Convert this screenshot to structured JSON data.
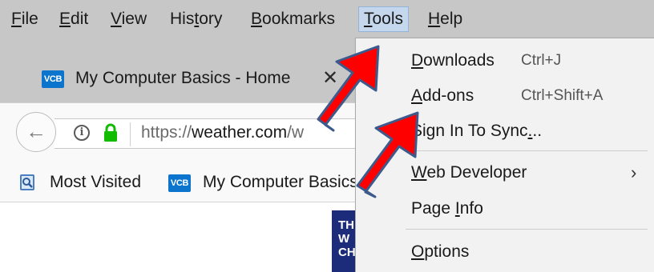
{
  "menubar": {
    "items": [
      {
        "label": "File",
        "underline_index": 0
      },
      {
        "label": "Edit",
        "underline_index": 0
      },
      {
        "label": "View",
        "underline_index": 0
      },
      {
        "label": "History",
        "underline_index": 3
      },
      {
        "label": "Bookmarks",
        "underline_index": 0
      },
      {
        "label": "Tools",
        "underline_index": 0,
        "active": true
      },
      {
        "label": "Help",
        "underline_index": 0
      }
    ]
  },
  "tab": {
    "favicon_text": "VCB",
    "title": "My Computer Basics - Home",
    "close_glyph": "✕"
  },
  "navbar": {
    "back_glyph": "←",
    "info_glyph": "i",
    "url_scheme": "https://",
    "url_domain": "weather.com",
    "url_rest": "/w"
  },
  "bookmarks": {
    "most_visited_label": "Most Visited",
    "favicon_text": "VCB",
    "site_label": "My Computer Basics"
  },
  "content": {
    "logo_lines": [
      "TH",
      "W",
      "CH"
    ]
  },
  "tools_menu": {
    "items": [
      {
        "label": "Downloads",
        "shortcut": "Ctrl+J",
        "underline_index": 0
      },
      {
        "label": "Add-ons",
        "shortcut": "Ctrl+Shift+A",
        "underline_index": 0
      },
      {
        "label": "Sign In To Sync...",
        "shortcut": "",
        "underline_index": 15
      },
      {
        "label": "Web Developer",
        "shortcut": "",
        "underline_index": 0,
        "submenu": true
      },
      {
        "label": "Page Info",
        "shortcut": "",
        "underline_index": 5
      },
      {
        "label": "Options",
        "shortcut": "",
        "underline_index": 0
      }
    ],
    "submenu_glyph": "›"
  },
  "colors": {
    "menubar_bg": "#c7c7c7",
    "active_menu_bg": "#c4d7ec",
    "toolbar_bg": "#f9f9f9",
    "dropdown_bg": "#f2f2f2",
    "favicon_blue": "#0b75ce",
    "lock_green": "#12bc00",
    "arrow_red": "#ff0000",
    "arrow_outline": "#3d5a8c",
    "logo_navy": "#1d2c7a"
  }
}
